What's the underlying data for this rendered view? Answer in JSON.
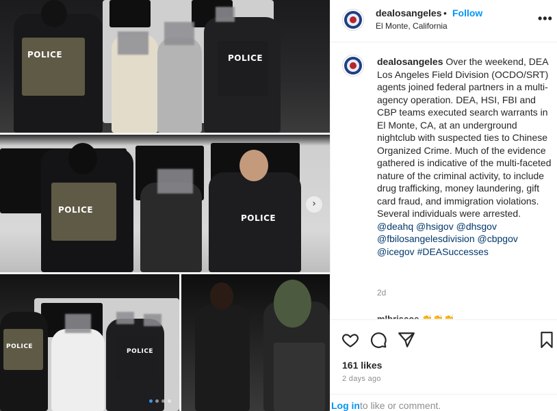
{
  "post": {
    "username": "dealosangeles",
    "dot": "•",
    "follow_label": "Follow",
    "location": "El Monte, California",
    "more_label": "•••"
  },
  "caption": {
    "username": "dealosangeles",
    "text": "Over the weekend, DEA Los Angeles Field Division (OCDO/SRT) agents joined federal partners in a multi-agency operation. DEA, HSI, FBI and CBP teams executed search warrants in El Monte, CA, at an underground nightclub with suspected ties to Chinese Organized Crime. Much of the evidence gathered is indicative of the multi-faceted nature of the criminal activity, to include drug trafficking, money laundering, gift card fraud, and immigration violations. Several individuals were arrested.",
    "mentions": "@deahq @hsigov @dhsgov @fbilosangelesdivision @cbpgov @icegov #DEASuccesses",
    "age": "2d",
    "next_comment_preview": "mlbriscoe 👏👏👏"
  },
  "photos": {
    "vest_label": "POLICE",
    "carousel_next": "›",
    "carousel_count": 4,
    "active_index": 0
  },
  "actions": {
    "like_icon": "heart-icon",
    "comment_icon": "comment-icon",
    "share_icon": "paper-plane-icon",
    "save_icon": "bookmark-icon",
    "likes": "161 likes",
    "time_ago": "2 days ago",
    "login_link": "Log in",
    "login_rest": "to like or comment."
  },
  "colors": {
    "accent": "#0095f6",
    "mention": "#00376b",
    "muted": "#8e8e8e",
    "text": "#262626"
  }
}
